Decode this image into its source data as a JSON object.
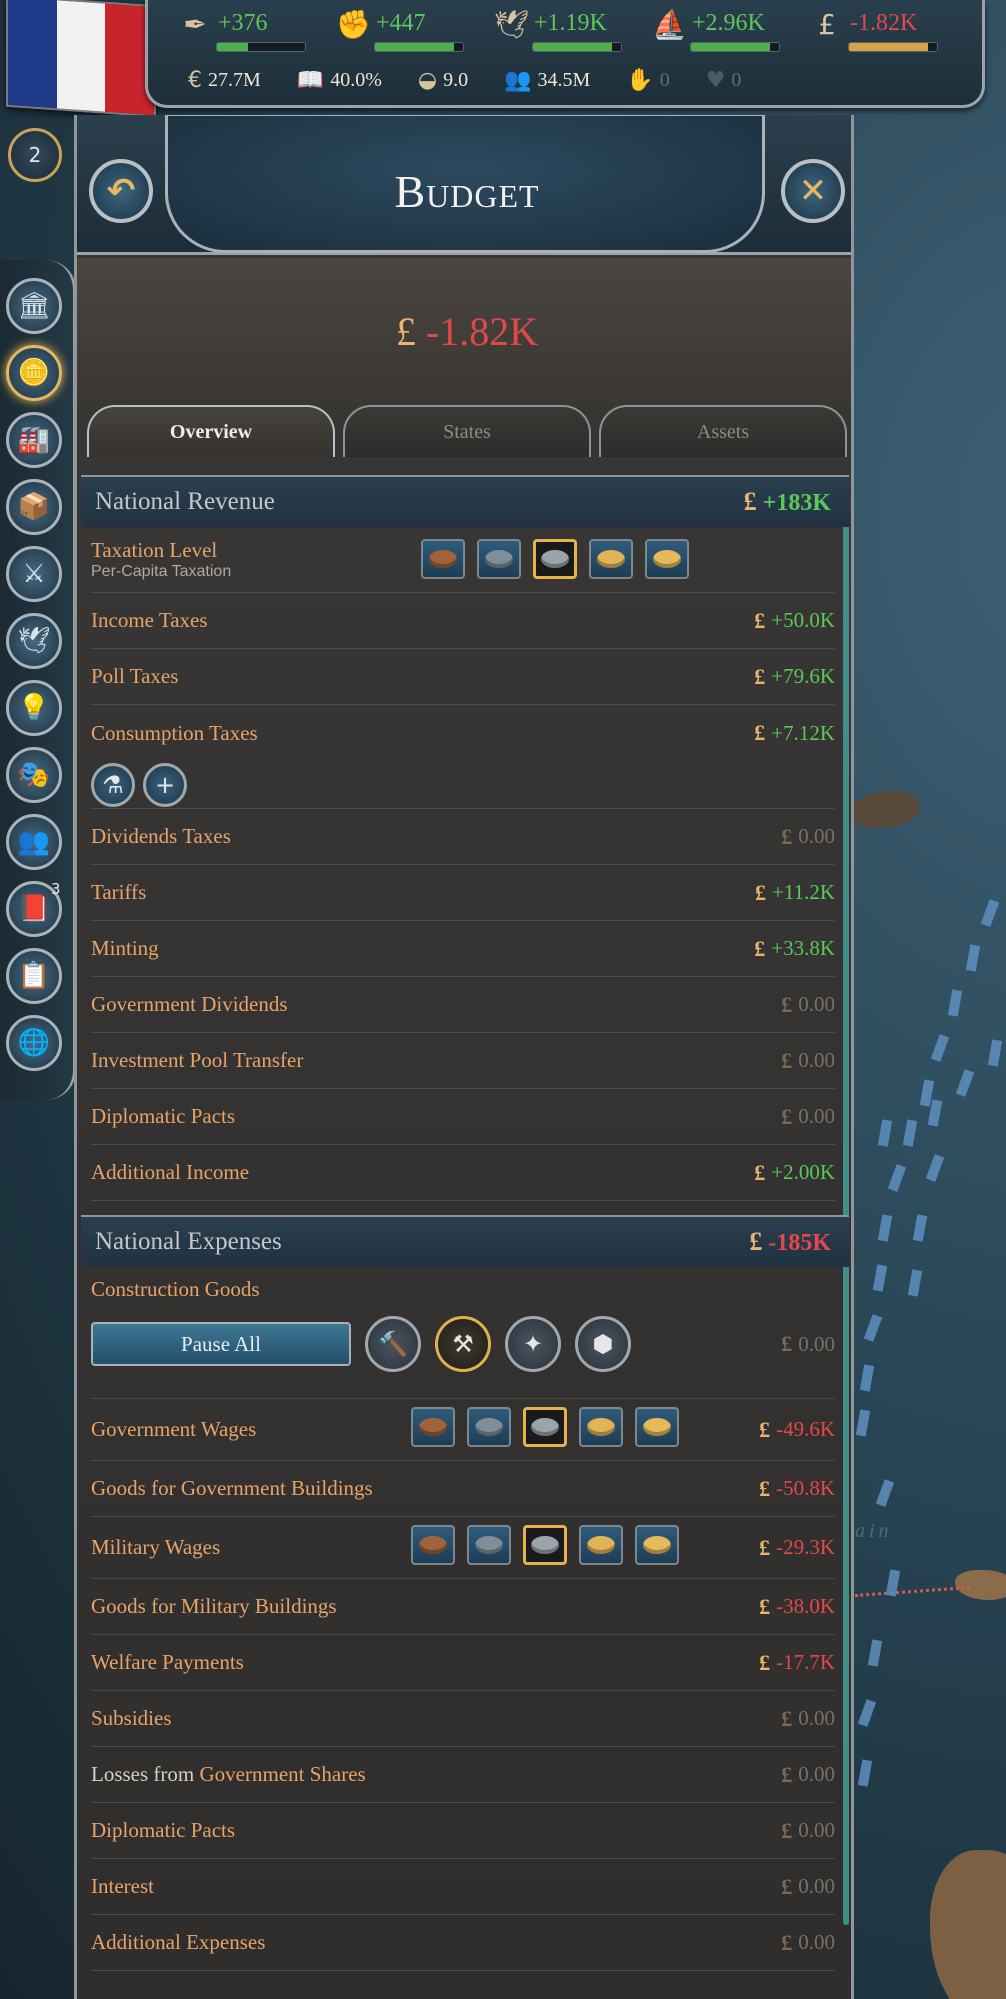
{
  "topbar": {
    "resources": [
      {
        "icon": "✒",
        "icon_name": "bureaucracy-icon",
        "value": "+376",
        "color": "#5cc75a",
        "fill": 0.35,
        "bar_color": "#4fae4b"
      },
      {
        "icon": "✊",
        "icon_name": "influence-icon",
        "value": "+447",
        "color": "#5cc75a",
        "fill": 0.9,
        "bar_color": "#4fae4b"
      },
      {
        "icon": "🕊",
        "icon_name": "authority-icon",
        "value": "+1.19K",
        "color": "#5cc75a",
        "fill": 0.9,
        "bar_color": "#4fae4b"
      },
      {
        "icon": "⛵",
        "icon_name": "navy-icon",
        "value": "+2.96K",
        "color": "#5cc75a",
        "fill": 0.9,
        "bar_color": "#4fae4b"
      },
      {
        "icon": "£",
        "icon_name": "money-icon",
        "value": "-1.82K",
        "color": "#e3484b",
        "fill": 0.9,
        "bar_color": "#d6a24a"
      }
    ],
    "stats": [
      {
        "icon": "€",
        "icon_name": "gdp-icon",
        "value": "27.7M",
        "dim": false
      },
      {
        "icon": "📖",
        "icon_name": "literacy-icon",
        "value": "40.0%",
        "dim": false
      },
      {
        "icon": "◒",
        "icon_name": "standard-of-living-icon",
        "value": "9.0",
        "dim": false
      },
      {
        "icon": "👥",
        "icon_name": "population-icon",
        "value": "34.5M",
        "dim": false
      },
      {
        "icon": "✋",
        "icon_name": "radicals-icon",
        "value": "0",
        "dim": true
      },
      {
        "icon": "♥",
        "icon_name": "loyalists-icon",
        "value": "0",
        "dim": true
      }
    ],
    "rank": "2"
  },
  "sidenav": [
    {
      "name": "nav-government",
      "icon": "🏛",
      "active": false
    },
    {
      "name": "nav-budget",
      "icon": "🪙",
      "active": true
    },
    {
      "name": "nav-industry",
      "icon": "🏭",
      "active": false
    },
    {
      "name": "nav-market",
      "icon": "📦",
      "active": false
    },
    {
      "name": "nav-military",
      "icon": "⚔",
      "active": false
    },
    {
      "name": "nav-diplomacy",
      "icon": "🕊",
      "active": false
    },
    {
      "name": "nav-technology",
      "icon": "💡",
      "active": false
    },
    {
      "name": "nav-politics",
      "icon": "🎭",
      "active": false
    },
    {
      "name": "nav-population",
      "icon": "👥",
      "active": false
    },
    {
      "name": "nav-journal",
      "icon": "📕",
      "active": false,
      "badge": "3"
    },
    {
      "name": "nav-ledger",
      "icon": "📋",
      "active": false
    },
    {
      "name": "nav-outliner",
      "icon": "🌐",
      "active": false
    }
  ],
  "panel": {
    "title": "Budget",
    "back_icon": "↶",
    "close_icon": "✕",
    "total": "-1.82K",
    "pound": "£",
    "tabs": [
      "Overview",
      "States",
      "Assets"
    ]
  },
  "revenue": {
    "title": "National Revenue",
    "total": "+183K",
    "taxation": {
      "label": "Taxation Level",
      "sub": "Per-Capita Taxation"
    },
    "rows": [
      {
        "label": "Income Taxes",
        "value": "+50.0K",
        "kind": "pos"
      },
      {
        "label": "Poll Taxes",
        "value": "+79.6K",
        "kind": "pos"
      },
      {
        "label": "Consumption Taxes",
        "value": "+7.12K",
        "kind": "pos"
      },
      {
        "label": "Dividends Taxes",
        "value": "0.00",
        "kind": "zero"
      },
      {
        "label": "Tariffs",
        "value": "+11.2K",
        "kind": "pos"
      },
      {
        "label": "Minting",
        "value": "+33.8K",
        "kind": "pos"
      },
      {
        "label": "Government Dividends",
        "value": "0.00",
        "kind": "zero"
      },
      {
        "label": "Investment Pool Transfer",
        "value": "0.00",
        "kind": "zero"
      },
      {
        "label": "Diplomatic Pacts",
        "value": "0.00",
        "kind": "zero"
      },
      {
        "label": "Additional Income",
        "value": "+2.00K",
        "kind": "pos"
      }
    ],
    "consumption_icons": [
      "⚗",
      "+"
    ]
  },
  "expenses": {
    "title": "National Expenses",
    "total": "-185K",
    "construction": {
      "label": "Construction Goods",
      "pause_label": "Pause All",
      "value": "0.00",
      "icons": [
        "🔨",
        "⚒",
        "✦",
        "⬢"
      ]
    },
    "rows": [
      {
        "label": "Government Wages",
        "value": "-49.6K",
        "kind": "neg",
        "levels": true
      },
      {
        "label": "Goods for Government Buildings",
        "value": "-50.8K",
        "kind": "neg",
        "levels": false
      },
      {
        "label": "Military Wages",
        "value": "-29.3K",
        "kind": "neg",
        "levels": true
      },
      {
        "label": "Goods for Military Buildings",
        "value": "-38.0K",
        "kind": "neg",
        "levels": false
      },
      {
        "label": "Welfare Payments",
        "value": "-17.7K",
        "kind": "neg",
        "levels": false
      },
      {
        "label": "Subsidies",
        "value": "0.00",
        "kind": "zero",
        "levels": false
      },
      {
        "label_plain": "Losses from ",
        "label": "Government Shares",
        "value": "0.00",
        "kind": "zero",
        "levels": false
      },
      {
        "label": "Diplomatic Pacts",
        "value": "0.00",
        "kind": "zero",
        "levels": false
      },
      {
        "label": "Interest",
        "value": "0.00",
        "kind": "zero",
        "levels": false
      },
      {
        "label": "Additional Expenses",
        "value": "0.00",
        "kind": "zero",
        "levels": false
      }
    ]
  },
  "level_coins": [
    "#a0633a",
    "#7f8e98",
    "#9aa4ab",
    "#e0b455",
    "#e6b95a"
  ],
  "selected_level": 2,
  "map_label": "ain"
}
